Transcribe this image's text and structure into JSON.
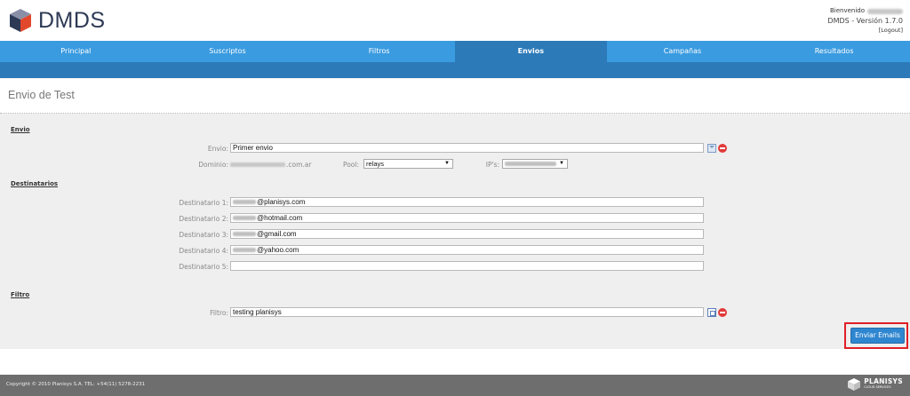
{
  "header": {
    "logo_text": "DMDS",
    "welcome": "Bienvenido",
    "version": "DMDS - Versión 1.7.0",
    "logout": "[Logout]"
  },
  "nav": {
    "tabs": [
      {
        "label": "Principal"
      },
      {
        "label": "Suscriptos"
      },
      {
        "label": "Filtros"
      },
      {
        "label": "Envios",
        "active": true
      },
      {
        "label": "Campañas"
      },
      {
        "label": "Resultados"
      }
    ]
  },
  "page": {
    "title": "Envio de Test"
  },
  "envio": {
    "section": "Envio",
    "envio_label": "Envio:",
    "envio_value": "Primer envio",
    "dominio_label": "Dominio:",
    "dominio_suffix": ".com.ar",
    "pool_label": "Pool:",
    "pool_value": "relays",
    "ips_label": "IP's:"
  },
  "destinatarios": {
    "section": "Destinatarios",
    "items": [
      {
        "label": "Destinatario 1:",
        "value": "@planisys.com"
      },
      {
        "label": "Destinatario 2:",
        "value": "@hotmail.com"
      },
      {
        "label": "Destinatario 3:",
        "value": "@gmail.com"
      },
      {
        "label": "Destinatario 4:",
        "value": "@yahoo.com"
      },
      {
        "label": "Destinatario 5:",
        "value": ""
      }
    ]
  },
  "filtro": {
    "section": "Filtro",
    "label": "Filtro:",
    "value": "testing planisys"
  },
  "actions": {
    "send": "Enviar Emails"
  },
  "footer": {
    "copyright": "Copyright © 2010 Planisys S.A. TEL: +54(11) 5278-2231",
    "brand": "PLANISYS",
    "brand_sub": "CLOUD SERVICES"
  },
  "colors": {
    "nav": "#3a9be0",
    "nav_active": "#2c7ab8",
    "panel": "#efefef",
    "footer": "#6e6e6e",
    "highlight": "#e01f26"
  }
}
